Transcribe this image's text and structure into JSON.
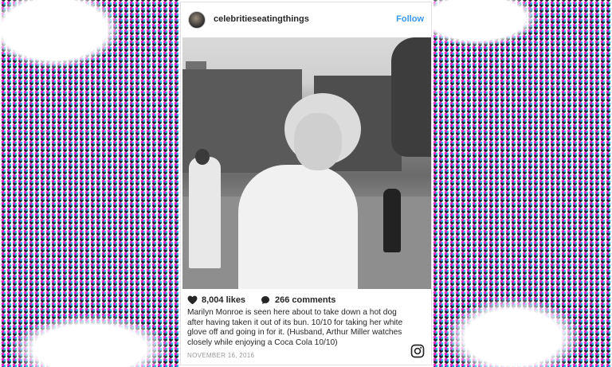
{
  "post": {
    "username": "celebritieseatingthings",
    "follow_label": "Follow",
    "likes": "8,004 likes",
    "comments": "266 comments",
    "caption": "Marilyn Monroe is seen here about to take down a hot dog after having taken it out of its bun. 10/10 for taking her white glove off and going in for it. (Husband, Arthur Miller watches closely while enjoying a Coca Cola 10/10)",
    "date": "NOVEMBER 16, 2016"
  },
  "icons": {
    "heart": "heart-icon",
    "comment": "comment-bubble-icon",
    "instagram": "instagram-icon"
  },
  "colors": {
    "follow_blue": "#3897f0",
    "text": "#262626",
    "date_gray": "#999999"
  }
}
